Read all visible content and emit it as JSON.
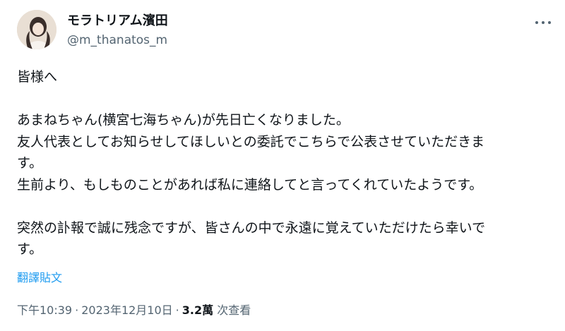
{
  "author": {
    "display_name": "モラトリアム濱田",
    "handle": "@m_thanatos_m"
  },
  "tweet": {
    "lines": [
      "皆様へ",
      "",
      "あまねちゃん(横宮七海ちゃん)が先日亡くなりました。",
      "友人代表としてお知らせしてほしいとの委託でこちらで公表させていただきま",
      "す。",
      "生前より、もしものことがあれば私に連絡してと言ってくれていたようです。",
      "",
      "突然の訃報で誠に残念ですが、皆さんの中で永遠に覚えていただけたら幸いで",
      "す。"
    ],
    "translate_label": "翻譯貼文"
  },
  "meta": {
    "time": "下午10:39",
    "date": "2023年12月10日",
    "views_count": "3.2萬",
    "views_label": "次查看",
    "separator": "·"
  },
  "icons": {
    "more": "more-horizontal-icon"
  }
}
